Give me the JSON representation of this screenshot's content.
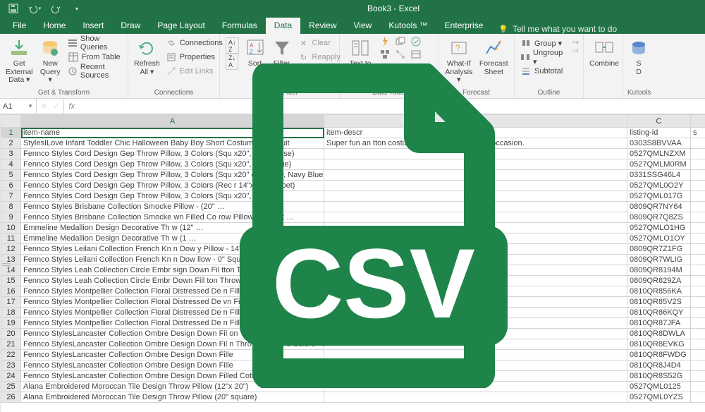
{
  "titlebar": {
    "title": "Book3 - Excel"
  },
  "tabs": {
    "items": [
      "File",
      "Home",
      "Insert",
      "Draw",
      "Page Layout",
      "Formulas",
      "Data",
      "Review",
      "View",
      "Kutools ™",
      "Enterprise"
    ],
    "active": 6,
    "tellme": "Tell me what you want to do"
  },
  "ribbon": {
    "groups": [
      {
        "label": "Get & Transform",
        "big": [
          {
            "icon": "download",
            "label": "Get External\nData ▾"
          },
          {
            "icon": "query",
            "label": "New\nQuery ▾"
          }
        ],
        "small": [
          "Show Queries",
          "From Table",
          "Recent Sources"
        ]
      },
      {
        "label": "Connections",
        "big": [
          {
            "icon": "refresh",
            "label": "Refresh\nAll ▾"
          }
        ],
        "small": [
          "Connections",
          "Properties",
          "Edit Links"
        ]
      },
      {
        "label": "Sort & Filter",
        "big": [
          {
            "icon": "sortAZ",
            "label": ""
          },
          {
            "icon": "sort",
            "label": "Sort"
          },
          {
            "icon": "filter",
            "label": "Filter"
          }
        ],
        "small": [
          "Clear",
          "Reapply"
        ],
        "pre": [
          "A↓Z",
          "Z↓A"
        ]
      },
      {
        "label": "Data Tools",
        "big": [
          {
            "icon": "ttc",
            "label": "Text to\nColumns"
          }
        ],
        "icons": [
          "flash",
          "dup",
          "valid",
          "consol",
          "rel",
          "model"
        ]
      },
      {
        "label": "Forecast",
        "big": [
          {
            "icon": "whatif",
            "label": "What-If\nAnalysis ▾"
          },
          {
            "icon": "fsheet",
            "label": "Forecast\nSheet"
          }
        ]
      },
      {
        "label": "Outline",
        "small2": [
          "Group ▾",
          "Ungroup ▾",
          "Subtotal"
        ]
      },
      {
        "label": "",
        "big": [
          {
            "icon": "combine",
            "label": "Combine"
          }
        ]
      },
      {
        "label": "Kutools",
        "big": [
          {
            "icon": "sdata",
            "label": "S\nD"
          }
        ]
      }
    ]
  },
  "namebox": "A1",
  "columns": [
    "",
    "A",
    "B",
    "C",
    ""
  ],
  "headers": {
    "A": "item-name",
    "B": "item-descr",
    "C": "listing-id",
    "D": "s"
  },
  "b2": "Super fun an                                    tton costume for halloween or any occasion.",
  "rows": [
    {
      "r": 2,
      "A": "StylesILove Infant Toddler Chic Halloween Baby Boy Short            Costume Bodysuit",
      "C": "0303S8BVVAA"
    },
    {
      "r": 3,
      "A": "Fennco Styles Cord Design Gep Throw Pillow, 3 Colors (Squ          x20\", Chartreuse)",
      "C": "0527QMLNZXM"
    },
    {
      "r": 4,
      "A": "Fennco Styles Cord Design Gep Throw Pillow, 3 Colors (Squ          x20\", Navy Blue)",
      "C": "0527QMLM0RM"
    },
    {
      "r": 5,
      "A": "Fennco Styles Cord Design Gep Throw Pillow, 3 Colors (Squ          x20\" case only, Navy Blue)",
      "C": "0331SSG46L4"
    },
    {
      "r": 6,
      "A": "Fennco Styles Cord Design Gep Throw Pillow, 3 Colors (Rec          r 14\"x23\", Sorbet)",
      "C": "0527QML0O2Y"
    },
    {
      "r": 7,
      "A": "Fennco Styles Cord Design Gep Throw Pillow, 3 Colors (Squ          x20\", Sorbet)",
      "C": "0527QML017G"
    },
    {
      "r": 8,
      "A": "Fennco Styles Brisbane Collection Smocke                                     Pillow -                 (20\" …",
      "C": "0809QR7NY64"
    },
    {
      "r": 9,
      "A": "Fennco Styles Brisbane Collection Smocke            wn Filled Co         row Pillow -           s (20\"x …",
      "C": "0809QR7Q8ZS"
    },
    {
      "r": 10,
      "A": "Emmeline Medallion Design Decorative Th            w (12\"                                              …",
      "C": "0527QMLO1HG"
    },
    {
      "r": 11,
      "A": "Emmeline Medallion Design Decorative Th            w (1                                                 …",
      "C": "0527QMLO1OY"
    },
    {
      "r": 12,
      "A": "Fennco Styles Leilani Collection French Kn            n Dow                    y Pillow -         14\"x23\")",
      "C": "0809QR7Z1FG"
    },
    {
      "r": 13,
      "A": "Fennco Styles Leilani Collection French Kn            n Dow                    llow -        0\" Square)",
      "C": "0809QR7WLIG"
    },
    {
      "r": 14,
      "A": "Fennco Styles Leah Collection Circle Embr            sign Down Fil        tton Throw Pil         es (14\"x2 …",
      "C": "0809QR8194M"
    },
    {
      "r": 15,
      "A": "Fennco Styles Leah Collection Circle Embr                  Down Fill        ton Throw Pil              (20\"x2 …",
      "C": "0809QR829ZA"
    },
    {
      "r": 16,
      "A": "Fennco Styles Montpellier Collection Floral Distressed De           n Filled Cotton Throw Pillow - 2 Colors - 2 Sizes (14\"x23\", Grey)",
      "C": "0810QR856KA"
    },
    {
      "r": 17,
      "A": "Fennco Styles Montpellier Collection Floral Distressed De          vn Filled Cotton Throw Pillow - 2 Colors - 2 Sizes (20\" Square, Gr…",
      "C": "0810QR85V2S"
    },
    {
      "r": 18,
      "A": "Fennco Styles Montpellier Collection Floral Distressed De          n Filled Cotton Throw Pillow - 2 Colors - 2 Sizes (14\"x23\", Navy …",
      "C": "0810QR86KQY"
    },
    {
      "r": 19,
      "A": "Fennco Styles Montpellier Collection Floral Distressed De          n Filled Cotton Throw Pillow - 2 Colors - 2 Sizes (20\" Square, Na…",
      "C": "0810QR87JFA"
    },
    {
      "r": 20,
      "A": "Fennco StylesLancaster Collection Ombre Design Down Fil           on Throw Pillow - 3 Colors - 2 Sizes (14\"x23\", Fog)",
      "C": "0810QR8DWLA"
    },
    {
      "r": 21,
      "A": "Fennco StylesLancaster Collection Ombre Design Down Fil            n Throw Pillow - 3 Colors - 2 Sizes (20\" Square, Fog)",
      "C": "0810QR8EVKG"
    },
    {
      "r": 22,
      "A": "Fennco StylesLancaster Collection Ombre Design Down Fille",
      "C": "0810QR8FWDG"
    },
    {
      "r": 23,
      "A": "Fennco StylesLancaster Collection Ombre Design Down Fille",
      "C": "0810QR8J4D4"
    },
    {
      "r": 24,
      "A": "Fennco StylesLancaster Collection Ombre Design Down Filled Cotton Throw Pillow - 3 Colors - 2 Sizes (20\" Square, Navy Blue)",
      "C": "0810QR8S52G"
    },
    {
      "r": 25,
      "A": "Alana Embroidered Moroccan Tile Design Throw Pillow (12\"x 20\")",
      "C": "0527QML0125"
    },
    {
      "r": 26,
      "A": "Alana Embroidered Moroccan Tile Design Throw Pillow (20\" square)",
      "C": "0527QML0YZS"
    }
  ],
  "colors": {
    "excel_green": "#217346"
  }
}
